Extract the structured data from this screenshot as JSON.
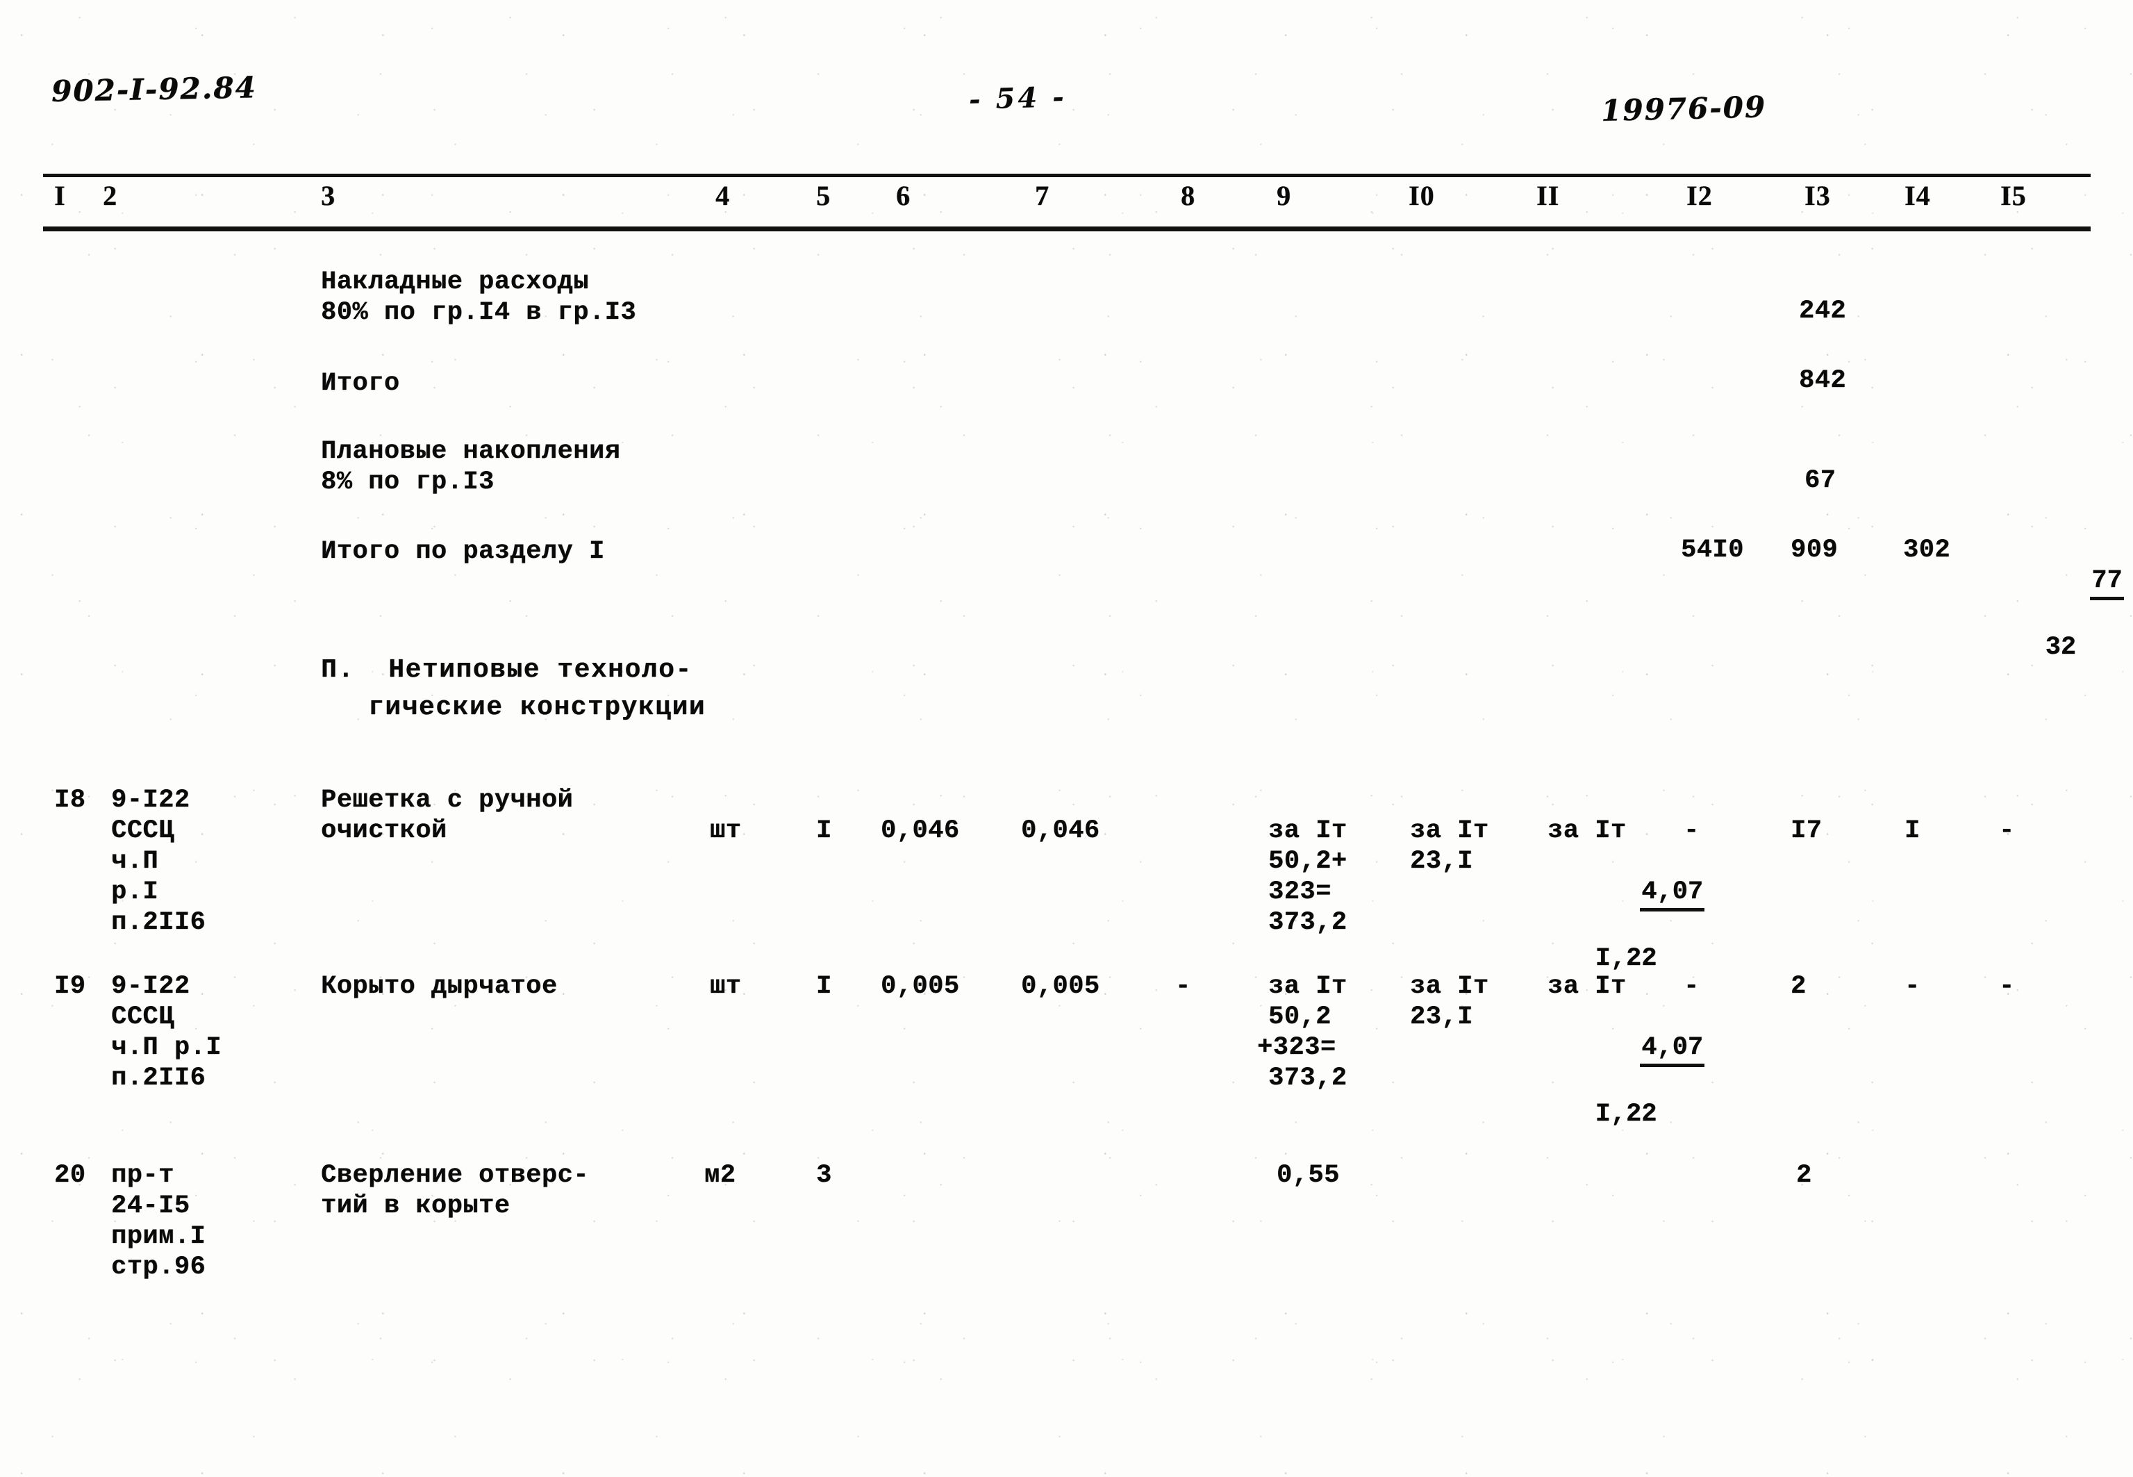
{
  "header": {
    "doc_code": "902-I-92.84",
    "page_marker": "- 54 -",
    "archive_code": "19976-09"
  },
  "table": {
    "column_numbers": [
      "I",
      "2",
      "3",
      "4",
      "5",
      "6",
      "7",
      "8",
      "9",
      "I0",
      "II",
      "I2",
      "I3",
      "I4",
      "I5"
    ],
    "rows": [
      {
        "id": "overhead",
        "num": "",
        "code": "",
        "desc_line1": "Накладные расходы",
        "desc_line2": "80% по гр.I4 в гр.I3",
        "unit": "",
        "qty": "",
        "c6": "",
        "c7": "",
        "c8": "",
        "c9": "",
        "c10": "",
        "c11": "",
        "c12": "",
        "c13": "242",
        "c14": "",
        "c15": ""
      },
      {
        "id": "total-1",
        "num": "",
        "code": "",
        "desc_line1": "Итого",
        "desc_line2": "",
        "unit": "",
        "qty": "",
        "c13": "842"
      },
      {
        "id": "planned-savings",
        "num": "",
        "code": "",
        "desc_line1": "Плановые накопления",
        "desc_line2": "8% по гр.I3",
        "c13": "67"
      },
      {
        "id": "section-total",
        "num": "",
        "code": "",
        "desc_line1": "Итого по разделу I",
        "desc_line2": "",
        "c12": "54I0",
        "c13": "909",
        "c14": "302",
        "c15_num": "77",
        "c15_den": "32"
      },
      {
        "id": "item-18",
        "num": "I8",
        "code_line1": "9-I22",
        "code_line2": "СССЦ",
        "code_line3": "ч.П",
        "code_line4": "р.I",
        "code_line5": "п.2II6",
        "desc_line1": "Решетка с ручной",
        "desc_line2": "очисткой",
        "unit": "шт",
        "qty": "I",
        "c6": "0,046",
        "c7": "0,046",
        "c8": "",
        "c9_line1": "за Iт",
        "c9_line2": "50,2+",
        "c9_line3": "323=",
        "c9_line4": "373,2",
        "c10_line1": "за Iт",
        "c10_line2": "23,I",
        "c11_line1": "за Iт",
        "c11_num": "4,07",
        "c11_den": "I,22",
        "c12": "-",
        "c13": "I7",
        "c14": "I",
        "c15": "-"
      },
      {
        "id": "item-19",
        "num": "I9",
        "code_line1": "9-I22",
        "code_line2": "СССЦ",
        "code_line3": "ч.П р.I",
        "code_line4": "п.2II6",
        "desc_line1": "Корыто дырчатое",
        "desc_line2": "",
        "unit": "шт",
        "qty": "I",
        "c6": "0,005",
        "c7": "0,005",
        "c8": "-",
        "c9_line1": "за Iт",
        "c9_line2": "50,2",
        "c9_line3": "+323=",
        "c9_line4": "373,2",
        "c10_line1": "за Iт",
        "c10_line2": "23,I",
        "c11_line1": "за Iт",
        "c11_num": "4,07",
        "c11_den": "I,22",
        "c12": "-",
        "c13": "2",
        "c14": "-",
        "c15": "-"
      },
      {
        "id": "item-20",
        "num": "20",
        "code_line1": "пр-т",
        "code_line2": "24-I5",
        "code_line3": "прим.I",
        "code_line4": "стр.96",
        "desc_line1": "Сверление отверс-",
        "desc_line2": "тий в корыте",
        "unit": "м2",
        "qty": "3",
        "c6": "",
        "c7": "",
        "c8": "",
        "c9": "0,55",
        "c10": "",
        "c11": "",
        "c12": "",
        "c13": "2",
        "c14": "",
        "c15": ""
      }
    ],
    "section_heading": {
      "line1": "П.  Нетиповые техноло-",
      "line2": "гические конструкции"
    }
  }
}
